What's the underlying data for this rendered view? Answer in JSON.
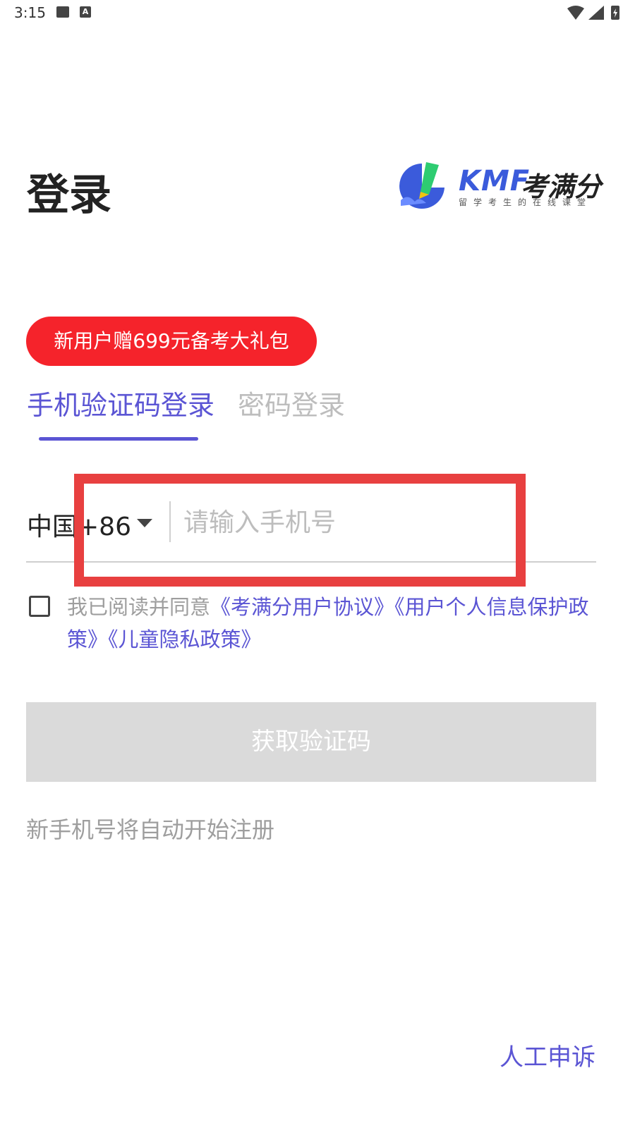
{
  "status_bar": {
    "time": "3:15",
    "left_icons": [
      "image-icon",
      "a-icon"
    ],
    "right_icons": [
      "wifi-icon",
      "signal-icon",
      "battery-icon"
    ]
  },
  "header": {
    "title": "登录",
    "logo": {
      "name": "KMF",
      "cn_name": "考满分",
      "tagline": "留学考生的在线课堂",
      "colors": {
        "primary": "#3b5bdb",
        "accent": "#2ecc71"
      }
    }
  },
  "promo": {
    "label": "新用户赠699元备考大礼包",
    "color": "#f5232b"
  },
  "tabs": [
    {
      "label": "手机验证码登录",
      "active": true
    },
    {
      "label": "密码登录",
      "active": false
    }
  ],
  "phone_field": {
    "country_code": "中国+86",
    "placeholder": "请输入手机号",
    "value": ""
  },
  "agreement": {
    "prefix": "我已阅读并同意",
    "links": [
      "《考满分用户协议》",
      "《用户个人信息保护政策》",
      "《儿童隐私政策》"
    ],
    "checked": false
  },
  "buttons": {
    "get_code": "获取验证码"
  },
  "hint": "新手机号将自动开始注册",
  "footer": {
    "appeal": "人工申诉"
  },
  "colors": {
    "accent": "#5b55d4",
    "promo": "#f5232b",
    "disabled_button": "#dadada",
    "highlight": "#e84040"
  }
}
